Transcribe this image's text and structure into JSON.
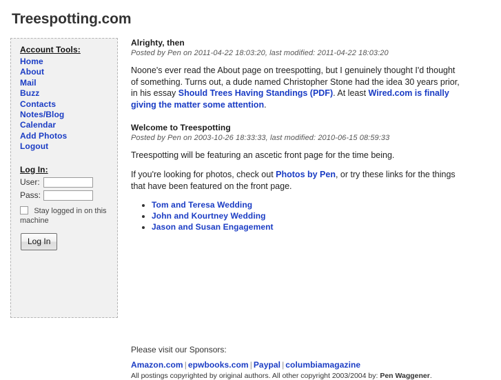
{
  "site": {
    "title": "Treespotting.com"
  },
  "sidebar": {
    "account_tools_heading": "Account Tools:",
    "nav_items": [
      {
        "label": "Home",
        "name": "sidebar-link-home"
      },
      {
        "label": "About",
        "name": "sidebar-link-about"
      },
      {
        "label": "Mail",
        "name": "sidebar-link-mail"
      },
      {
        "label": "Buzz",
        "name": "sidebar-link-buzz"
      },
      {
        "label": "Contacts",
        "name": "sidebar-link-contacts"
      },
      {
        "label": "Notes/Blog",
        "name": "sidebar-link-notes-blog"
      },
      {
        "label": "Calendar",
        "name": "sidebar-link-calendar"
      },
      {
        "label": "Add Photos",
        "name": "sidebar-link-add-photos"
      },
      {
        "label": "Logout",
        "name": "sidebar-link-logout"
      }
    ],
    "login": {
      "heading": "Log In:",
      "user_label": "User:",
      "user_value": "",
      "pass_label": "Pass:",
      "pass_value": "",
      "stay_logged_in_label": "Stay logged in on this machine",
      "stay_logged_in_checked": false,
      "submit_label": "Log In"
    }
  },
  "posts": [
    {
      "title": "Alrighty, then",
      "meta": "Posted by Pen on 2011-04-22 18:03:20, last modified: 2011-04-22 18:03:20",
      "paragraph_parts": {
        "text_1": "Noone's ever read the About page on treespotting, but I genuinely thought I'd thought of something. Turns out, a dude named Christopher Stone had the idea 30 years prior, in his essay ",
        "link_1": "Should Trees Having Standings (PDF)",
        "text_2": ". At least ",
        "link_2": "Wired.com is finally giving the matter some attention",
        "text_3": "."
      }
    },
    {
      "title": "Welcome to Treespotting",
      "meta": "Posted by Pen on 2003-10-26 18:33:33, last modified: 2010-06-15 08:59:33",
      "paragraph_1": "Treespotting will be featuring an ascetic front page for the time being.",
      "paragraph_2_parts": {
        "text_1": "If you're looking for photos, check out ",
        "link_1": "Photos by Pen",
        "text_2": ", or try these links for the things that have been featured on the front page."
      },
      "links": [
        {
          "label": "Tom and Teresa Wedding",
          "name": "post-link-tom-and-teresa-wedding"
        },
        {
          "label": "John and Kourtney Wedding",
          "name": "post-link-john-and-kourtney-wedding"
        },
        {
          "label": "Jason and Susan Engagement",
          "name": "post-link-jason-and-susan-engagement"
        }
      ]
    }
  ],
  "footer": {
    "sponsor_intro": "Please visit our Sponsors:",
    "sponsors": [
      {
        "label": "Amazon.com",
        "name": "sponsor-link-amazon"
      },
      {
        "label": "epwbooks.com",
        "name": "sponsor-link-epwbooks"
      },
      {
        "label": "Paypal",
        "name": "sponsor-link-paypal"
      },
      {
        "label": "columbiamagazine",
        "name": "sponsor-link-columbiamagazine"
      }
    ],
    "separator": "|",
    "copyright_text": "All postings copyrighted by original authors. All other copyright 2003/2004 by: ",
    "copyright_owner": "Pen Waggener",
    "copyright_suffix": "."
  },
  "colors": {
    "link_blue": "#1a3cc4",
    "sidebar_bg": "#f1f1f1",
    "sidebar_border": "#b4b4b4",
    "title_gray": "#333333"
  }
}
